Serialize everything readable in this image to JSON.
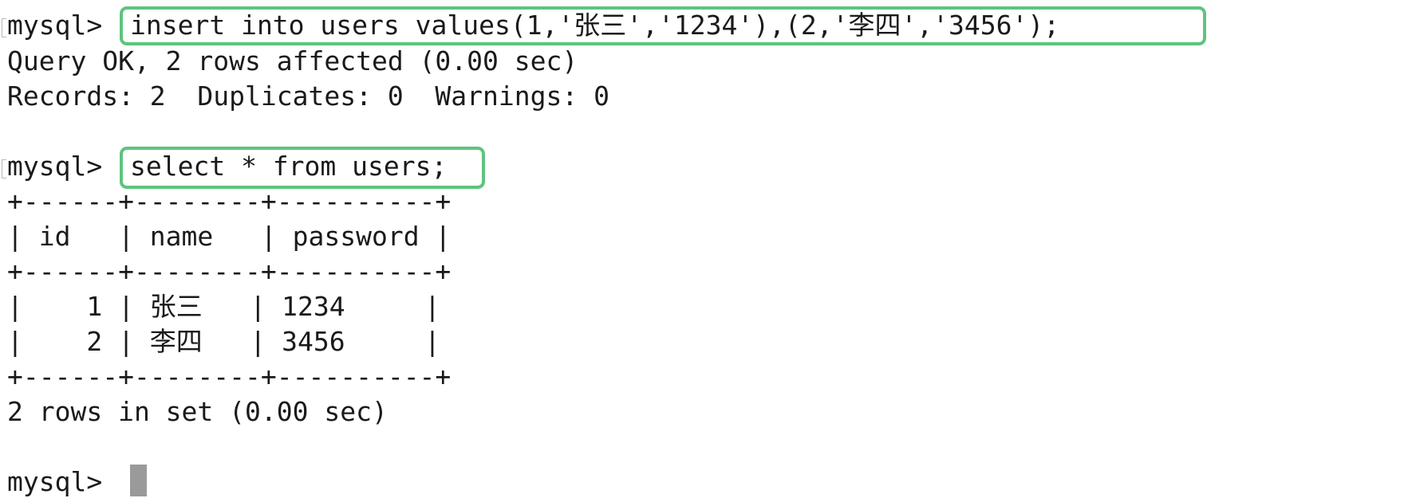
{
  "terminal": {
    "prompt": "mysql>",
    "insert_command": "insert into users values(1,'张三','1234'),(2,'李四','3456');",
    "insert_result_1": "Query OK, 2 rows affected (0.00 sec)",
    "insert_result_2": "Records: 2  Duplicates: 0  Warnings: 0",
    "select_command": "select * from users;",
    "table": {
      "border": "+------+--------+----------+",
      "header": "| id   | name   | password |",
      "rows": [
        "|    1 | 张三   | 1234     |",
        "|    2 | 李四   | 3456     |"
      ]
    },
    "select_result": "2 rows in set (0.00 sec)"
  },
  "colors": {
    "highlight_box": "#5ec47f",
    "cursor": "#9a9a9a"
  }
}
